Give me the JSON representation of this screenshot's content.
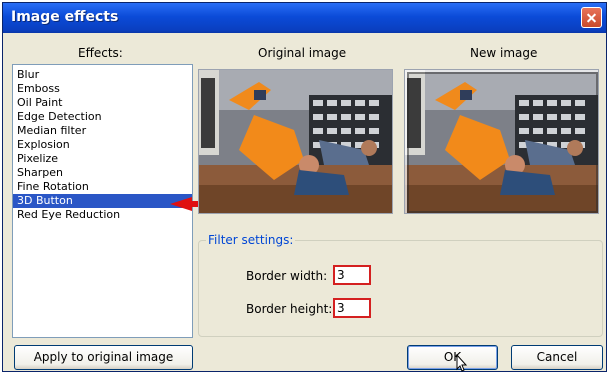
{
  "window": {
    "title": "Image effects"
  },
  "labels": {
    "effects": "Effects:",
    "original": "Original image",
    "new": "New image",
    "filter_settings": "Filter settings:",
    "border_width": "Border width:",
    "border_height": "Border height:"
  },
  "effects": [
    "Blur",
    "Emboss",
    "Oil Paint",
    "Edge Detection",
    "Median filter",
    "Explosion",
    "Pixelize",
    "Sharpen",
    "Fine Rotation",
    "3D Button",
    "Red Eye Reduction"
  ],
  "selected_effect": "3D Button",
  "fields": {
    "border_width": "3",
    "border_height": "3"
  },
  "buttons": {
    "apply": "Apply to original image",
    "ok": "OK",
    "cancel": "Cancel"
  },
  "colors": {
    "title_bar": "#0b4bd8",
    "selection": "#2a56c6",
    "highlight_border": "#d42020",
    "arrow": "#e01010"
  }
}
